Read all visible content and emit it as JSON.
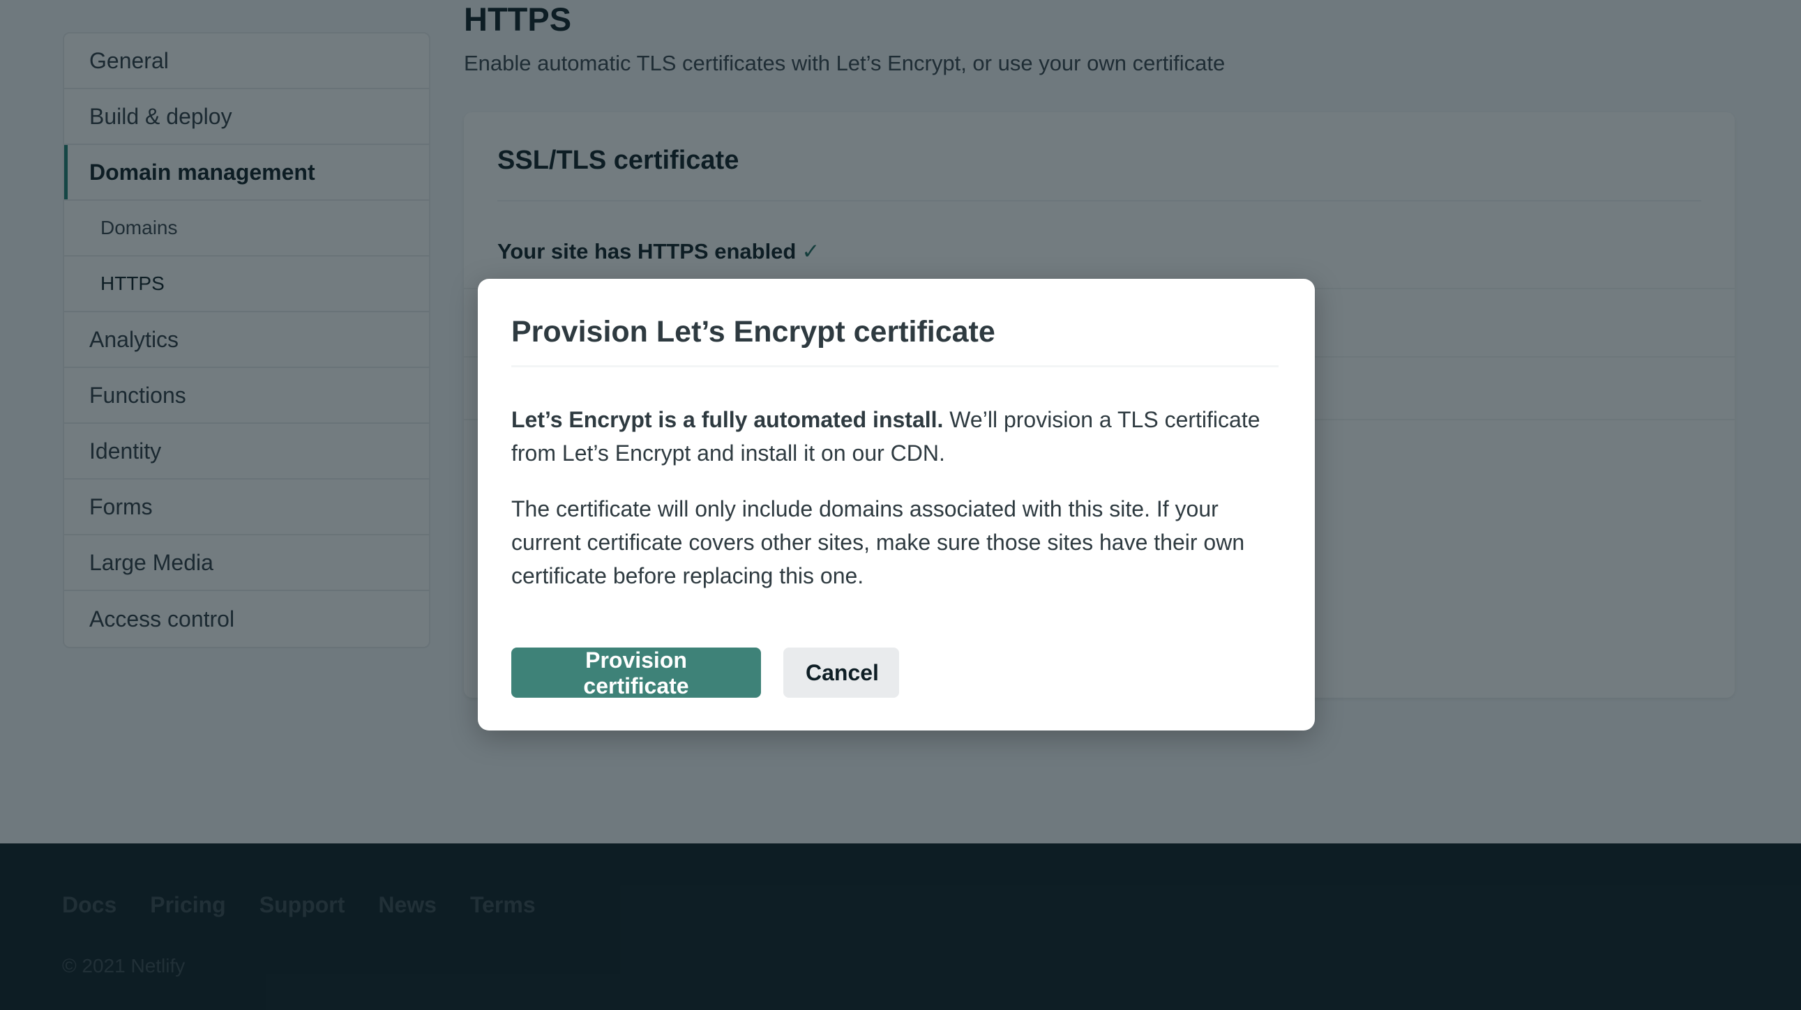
{
  "sidebar": {
    "items": [
      {
        "label": "General",
        "type": "top",
        "active": false
      },
      {
        "label": "Build & deploy",
        "type": "top",
        "active": false
      },
      {
        "label": "Domain management",
        "type": "top",
        "active": true
      },
      {
        "label": "Domains",
        "type": "sub",
        "active": false
      },
      {
        "label": "HTTPS",
        "type": "sub",
        "active": true
      },
      {
        "label": "Analytics",
        "type": "top",
        "active": false
      },
      {
        "label": "Functions",
        "type": "top",
        "active": false
      },
      {
        "label": "Identity",
        "type": "top",
        "active": false
      },
      {
        "label": "Forms",
        "type": "top",
        "active": false
      },
      {
        "label": "Large Media",
        "type": "top",
        "active": false
      },
      {
        "label": "Access control",
        "type": "top",
        "active": false
      }
    ]
  },
  "main": {
    "title": "HTTPS",
    "subtitle": "Enable automatic TLS certificates with Let’s Encrypt, or use your own certificate",
    "card": {
      "title": "SSL/TLS certificate",
      "status": "Your site has HTTPS enabled",
      "status_icon": "check-icon",
      "status_glyph": "✓"
    }
  },
  "modal": {
    "title": "Provision Let’s Encrypt certificate",
    "paragraph1_bold": "Let’s Encrypt is a fully automated install.",
    "paragraph1_rest": " We’ll provision a TLS certificate from Let’s Encrypt and install it on our CDN.",
    "paragraph2": "The certificate will only include domains associated with this site. If your current certificate covers other sites, make sure those sites have their own certificate before replacing this one.",
    "primary_button": "Provision certificate",
    "secondary_button": "Cancel"
  },
  "footer": {
    "links": [
      "Docs",
      "Pricing",
      "Support",
      "News",
      "Terms"
    ],
    "copyright": "© 2021 Netlify"
  },
  "colors": {
    "accent": "#3e8278",
    "active_indicator": "#1f7f72",
    "footer_bg": "#0e1e25",
    "overlay": "rgba(14,30,37,0.58)"
  }
}
